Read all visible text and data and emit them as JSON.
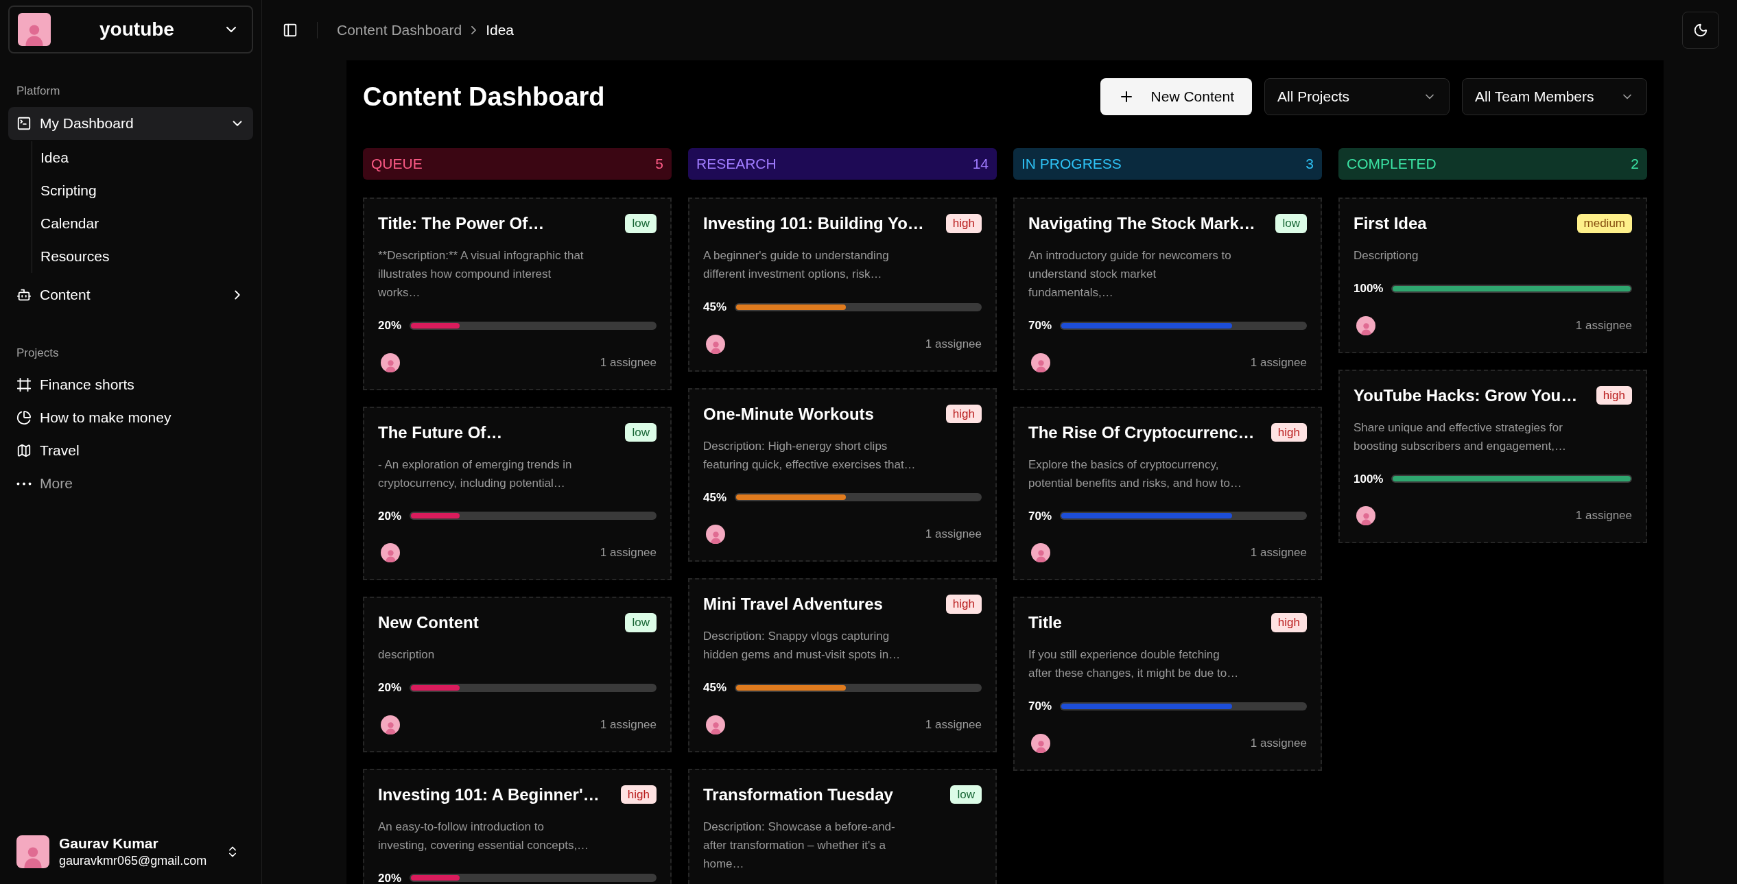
{
  "workspace": {
    "name": "youtube"
  },
  "sidebar": {
    "sections": [
      {
        "label": "Platform",
        "items": [
          {
            "label": "My Dashboard",
            "selected": true,
            "expanded": true,
            "children": [
              {
                "label": "Idea"
              },
              {
                "label": "Scripting"
              },
              {
                "label": "Calendar"
              },
              {
                "label": "Resources"
              }
            ]
          },
          {
            "label": "Content",
            "selected": false,
            "expanded": false
          }
        ]
      },
      {
        "label": "Projects",
        "items": [
          {
            "label": "Finance shorts",
            "selected": false
          },
          {
            "label": "How to make money",
            "selected": false
          },
          {
            "label": "Travel",
            "selected": false
          },
          {
            "label": "More",
            "selected": false,
            "muted": true
          }
        ]
      }
    ]
  },
  "user": {
    "name": "Gaurav Kumar",
    "email": "gauravkmr065@gmail.com"
  },
  "breadcrumb": [
    {
      "label": "Content Dashboard",
      "current": false
    },
    {
      "label": "Idea",
      "current": true
    }
  ],
  "page_title": "Content Dashboard",
  "new_button": "New Content",
  "filters": [
    "All Projects",
    "All Team Members"
  ],
  "columns": [
    {
      "name": "QUEUE",
      "count": "5",
      "kind": "queue",
      "cards": [
        {
          "title": "Title: The Power Of…",
          "priority": "low",
          "description": "**Description:** A visual infographic that illustrates how compound interest works…",
          "progress": "20%",
          "level": 0.2,
          "assignees": "1 assignee"
        },
        {
          "title": "The Future Of…",
          "priority": "low",
          "description": "- An exploration of emerging trends in cryptocurrency, including potential…",
          "progress": "20%",
          "level": 0.2,
          "assignees": "1 assignee"
        },
        {
          "title": "New Content",
          "priority": "low",
          "description": "description",
          "progress": "20%",
          "level": 0.2,
          "assignees": "1 assignee"
        },
        {
          "title": "Investing 101: A Beginner'…",
          "priority": "high",
          "description": "An easy-to-follow introduction to investing, covering essential concepts,…",
          "progress": "20%",
          "level": 0.2
        }
      ]
    },
    {
      "name": "RESEARCH",
      "count": "14",
      "kind": "research",
      "cards": [
        {
          "title": "Investing 101: Building Yo…",
          "priority": "high",
          "description": "A beginner's guide to understanding different investment options, risk…",
          "progress": "45%",
          "level": 0.45,
          "assignees": "1 assignee"
        },
        {
          "title": "One-Minute Workouts",
          "priority": "high",
          "description": "Description: High-energy short clips featuring quick, effective exercises that…",
          "progress": "45%",
          "level": 0.45,
          "assignees": "1 assignee"
        },
        {
          "title": "Mini Travel Adventures",
          "priority": "high",
          "description": "Description: Snappy vlogs capturing hidden gems and must-visit spots in…",
          "progress": "45%",
          "level": 0.45,
          "assignees": "1 assignee"
        },
        {
          "title": "Transformation Tuesday",
          "priority": "low",
          "description": "Description: Showcase a before-and-after transformation – whether it's a home…"
        }
      ]
    },
    {
      "name": "IN PROGRESS",
      "count": "3",
      "kind": "progress",
      "cards": [
        {
          "title": "Navigating The Stock Mark…",
          "priority": "low",
          "description": "An introductory guide for newcomers to understand stock market fundamentals,…",
          "progress": "70%",
          "level": 0.7,
          "assignees": "1 assignee"
        },
        {
          "title": "The Rise Of Cryptocurrenc…",
          "priority": "high",
          "description": "Explore the basics of cryptocurrency, potential benefits and risks, and how to…",
          "progress": "70%",
          "level": 0.7,
          "assignees": "1 assignee"
        },
        {
          "title": "Title",
          "priority": "high",
          "description": "If you still experience double fetching after these changes, it might be due to…",
          "progress": "70%",
          "level": 0.7,
          "assignees": "1 assignee"
        }
      ]
    },
    {
      "name": "COMPLETED",
      "count": "2",
      "kind": "completed",
      "cards": [
        {
          "title": "First Idea",
          "priority": "medium",
          "description": "Descriptiong",
          "progress": "100%",
          "level": 1,
          "assignees": "1 assignee"
        },
        {
          "title": "YouTube Hacks: Grow You…",
          "priority": "high",
          "description": "Share unique and effective strategies for boosting subscribers and engagement,…",
          "progress": "100%",
          "level": 1,
          "assignees": "1 assignee"
        }
      ]
    }
  ]
}
